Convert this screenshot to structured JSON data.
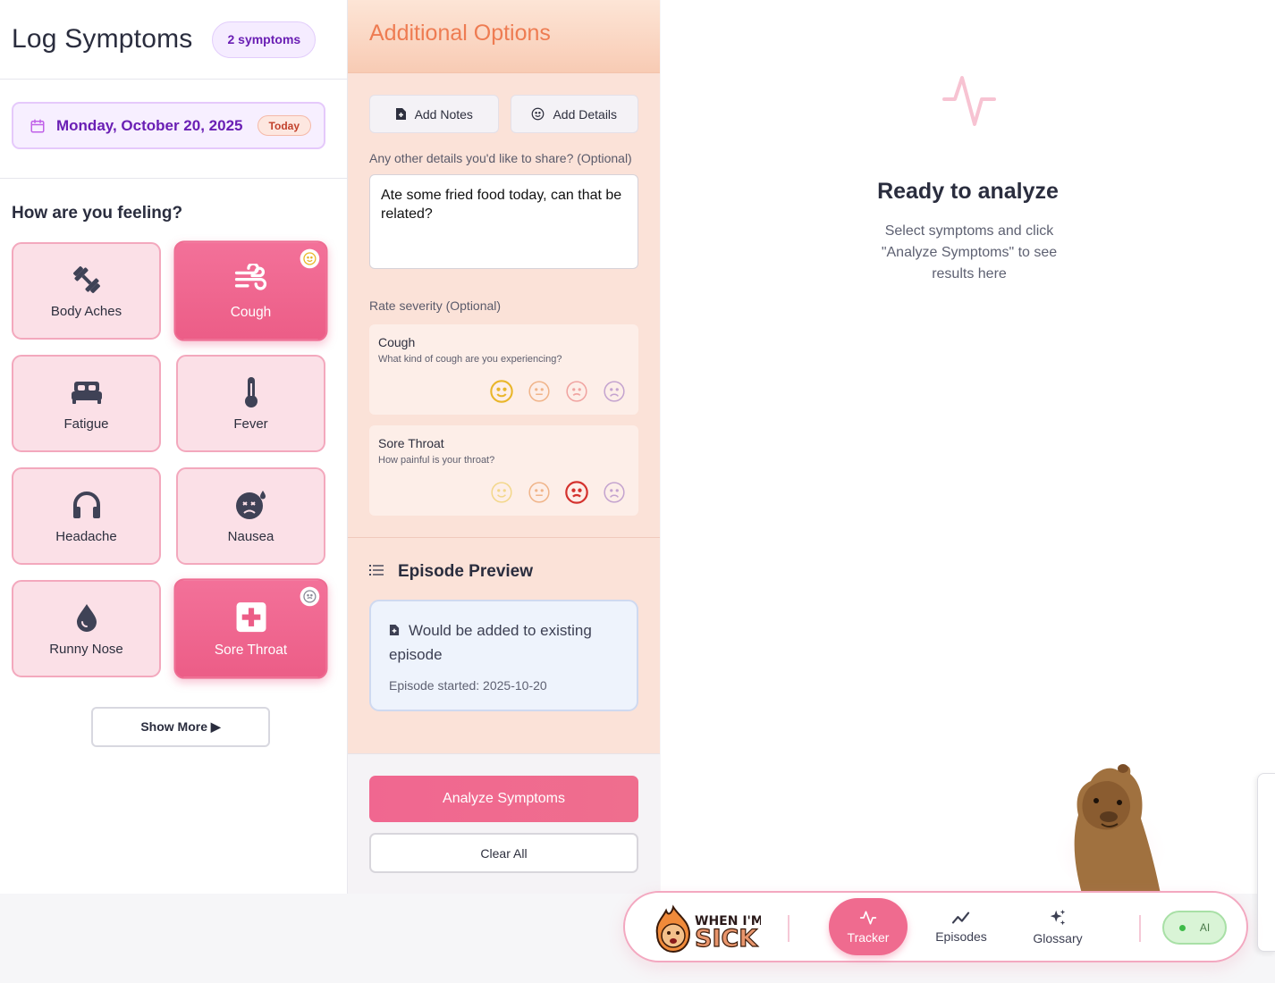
{
  "header": {
    "title": "Log Symptoms",
    "count_badge": "2 symptoms"
  },
  "date": {
    "label": "Monday, October 20, 2025",
    "badge": "Today"
  },
  "feeling": {
    "title": "How are you feeling?",
    "symptoms": [
      {
        "label": "Body Aches",
        "icon": "dumbbell-icon",
        "selected": false
      },
      {
        "label": "Cough",
        "icon": "wind-icon",
        "selected": true
      },
      {
        "label": "Fatigue",
        "icon": "bed-icon",
        "selected": false
      },
      {
        "label": "Fever",
        "icon": "thermometer-icon",
        "selected": false
      },
      {
        "label": "Headache",
        "icon": "headphones-icon",
        "selected": false
      },
      {
        "label": "Nausea",
        "icon": "dizzy-face-icon",
        "selected": false
      },
      {
        "label": "Runny Nose",
        "icon": "droplet-icon",
        "selected": false
      },
      {
        "label": "Sore Throat",
        "icon": "medical-kit-icon",
        "selected": true
      }
    ],
    "show_more": "Show More ▶"
  },
  "options": {
    "title": "Additional Options",
    "add_notes": "Add Notes",
    "add_details": "Add Details",
    "prompt": "Any other details you'd like to share? (Optional)",
    "notes_value": "Ate some fried food today, can that be related?",
    "severity_label": "Rate severity (Optional)",
    "severity": [
      {
        "name": "Cough",
        "question": "What kind of cough are you experiencing?",
        "selected_index": 0
      },
      {
        "name": "Sore Throat",
        "question": "How painful is your throat?",
        "selected_index": 2
      }
    ]
  },
  "episode": {
    "title": "Episode Preview",
    "message": "Would be added to existing episode",
    "started": "Episode started: 2025-10-20"
  },
  "actions": {
    "analyze": "Analyze Symptoms",
    "clear": "Clear All"
  },
  "results": {
    "title": "Ready to analyze",
    "subtitle": "Select symptoms and click \"Analyze Symptoms\" to see results here"
  },
  "nav": {
    "logo_text": "WHEN I'M SICK",
    "items": [
      {
        "label": "Tracker",
        "active": true
      },
      {
        "label": "Episodes",
        "active": false
      },
      {
        "label": "Glossary",
        "active": false
      }
    ],
    "ai_label": "AI"
  },
  "colors": {
    "accent_pink": "#ef6b8f",
    "accent_orange": "#ee7c52",
    "purple": "#6a1fb4",
    "ai_green": "#3dbb48"
  }
}
